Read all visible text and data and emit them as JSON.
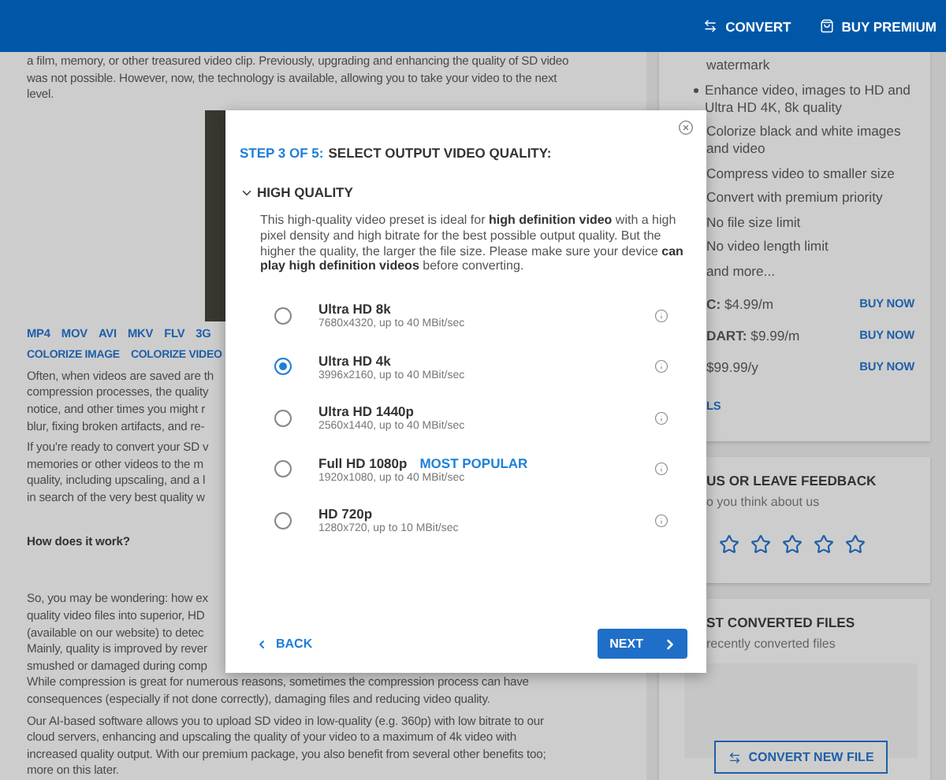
{
  "header": {
    "actions": [
      {
        "kind": "convert",
        "label": "CONVERT"
      },
      {
        "kind": "premium",
        "label": "BUY PREMIUM"
      }
    ]
  },
  "article": {
    "intro": [
      "a film, memory, or other treasured video clip. Previously, upgrading and enhancing the quality of SD video",
      "was not possible. However, now, the technology is available, allowing you to take your video to the next",
      "level."
    ],
    "format_links": [
      "MP4",
      "MOV",
      "AVI",
      "MKV",
      "FLV",
      "3G"
    ],
    "colorize_links": [
      "COLORIZE IMAGE",
      "COLORIZE VIDEO"
    ],
    "paragraphs": [
      [
        "Often, when videos are saved are th",
        "compression processes, the quality",
        "notice, and other times you might r",
        "blur, fixing broken artifacts, and re-"
      ],
      [
        "If you're ready to convert your SD v",
        "memories or other videos to the m",
        "quality, including upscaling, and a l",
        "in search of the very best quality w"
      ]
    ],
    "heading": "How does it work?",
    "paragraphs_2": [
      [
        "So, you may be wondering: how ex",
        "quality video files into superior, HD",
        "(available on our website) to detec",
        "Mainly, quality is improved by rever",
        "smushed or damaged during comp",
        "While compression is great for numerous reasons, sometimes the compression process can have",
        "consequences (especially if not done correctly), damaging files and reducing video quality."
      ],
      [
        "Our AI-based software allows you to upload SD video in low-quality (e.g. 360p) with low bitrate to our",
        "cloud servers, enhancing and upscaling the quality of your video to a maximum of 4k video with",
        "increased quality output. With our premium package, you also benefit from several other benefits too;",
        "more on this later."
      ]
    ]
  },
  "sidebar": {
    "features": [
      {
        "text": "watermark",
        "bullet": false
      },
      {
        "text": "Enhance video, images to HD and Ultra HD 4K, 8k quality",
        "bullet": true
      },
      {
        "text": "Colorize black and white images and video",
        "bullet": false
      },
      {
        "text": "Compress video to smaller size",
        "bullet": false
      },
      {
        "text": "Convert with premium priority",
        "bullet": false
      },
      {
        "text": "No file size limit",
        "bullet": false
      },
      {
        "text": "No video length limit",
        "bullet": false
      },
      {
        "text": "and more...",
        "bullet": false
      }
    ],
    "plans": [
      {
        "price": "**C:** $4.99/m",
        "action": "BUY NOW"
      },
      {
        "price": "**DART:** $9.99/m",
        "action": "BUY NOW"
      },
      {
        "price": "$99.99/y",
        "action": "BUY NOW"
      }
    ],
    "details_link": "LS",
    "feedback": {
      "title": "US OR LEAVE FEEDBACK",
      "subtitle": "o you think about us",
      "stars": 0
    },
    "converted": {
      "title": "ST CONVERTED FILES",
      "subtitle": "recently converted files",
      "button": "CONVERT NEW FILE"
    }
  },
  "dialog": {
    "step": "STEP 3 OF 5:",
    "title": "SELECT OUTPUT VIDEO QUALITY:",
    "section": {
      "label": "HIGH QUALITY",
      "expanded": true
    },
    "description": "This high-quality video preset is ideal for **high definition video** with a high pixel density and high bitrate for the best possible output quality. But the higher the quality, the larger the file size. Please make sure your device **can play high definition videos** before converting.",
    "options": [
      {
        "name": "Ultra HD 8k",
        "detail": "7680x4320, up to 40 MBit/sec",
        "selected": false
      },
      {
        "name": "Ultra HD 4k",
        "detail": "3996x2160, up to 40 MBit/sec",
        "selected": true
      },
      {
        "name": "Ultra HD 1440p",
        "detail": "2560x1440, up to 40 MBit/sec",
        "selected": false
      },
      {
        "name": "Full HD 1080p",
        "badge": "MOST POPULAR",
        "detail": "1920x1080, up to 40 MBit/sec",
        "selected": false
      },
      {
        "name": "HD 720p",
        "detail": "1280x720, up to 10 MBit/sec",
        "selected": false
      }
    ],
    "back": "BACK",
    "next": "NEXT"
  }
}
